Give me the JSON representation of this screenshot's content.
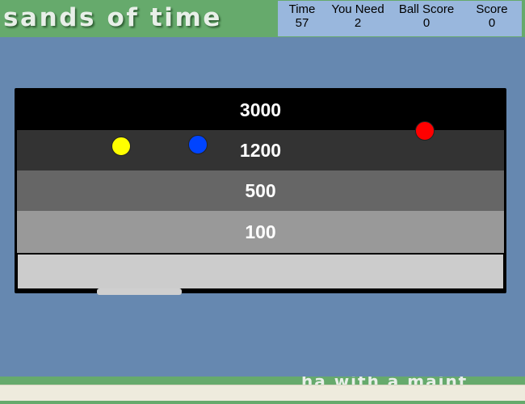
{
  "header": {
    "title": "sands of time",
    "stats": [
      {
        "label": "Time",
        "value": "57"
      },
      {
        "label": "You Need",
        "value": "2"
      },
      {
        "label": "Ball Score",
        "value": "0"
      },
      {
        "label": "Score",
        "value": "0"
      }
    ]
  },
  "board": {
    "rows": [
      "3000",
      "1200",
      "500",
      "100"
    ],
    "row_colors": [
      "#000000",
      "#333333",
      "#666666",
      "#999999"
    ],
    "tray_color": "#cccccc"
  },
  "balls": [
    {
      "name": "red",
      "color": "#ff0000"
    },
    {
      "name": "yellow",
      "color": "#ffff00"
    },
    {
      "name": "blue",
      "color": "#0044ff"
    }
  ],
  "footer": {
    "ticker": "ha with a  maint"
  },
  "colors": {
    "background": "#6688b0",
    "header_green": "#66aa6c",
    "scorebox": "#99b7dd"
  }
}
